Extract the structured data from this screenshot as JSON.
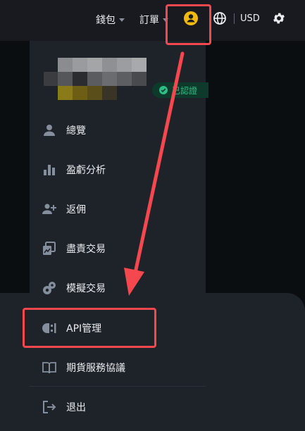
{
  "topbar": {
    "wallet_label": "錢包",
    "orders_label": "訂單",
    "user_icon": "user-circle-icon",
    "globe_icon": "globe-icon",
    "currency": "USD",
    "settings_icon": "gear-icon"
  },
  "profile": {
    "verified_label": "已認證",
    "verified_icon": "check-shield-icon"
  },
  "menu": {
    "items": [
      {
        "label": "總覽",
        "icon": "user-icon"
      },
      {
        "label": "盈虧分析",
        "icon": "bar-chart-icon"
      },
      {
        "label": "返佣",
        "icon": "add-user-icon"
      },
      {
        "label": "盡責交易",
        "icon": "trade-icon"
      },
      {
        "label": "模擬交易",
        "icon": "coins-icon"
      },
      {
        "label": "API管理",
        "icon": "api-icon"
      },
      {
        "label": "期貨服務協議",
        "icon": "book-icon"
      },
      {
        "label": "退出",
        "icon": "logout-icon"
      }
    ]
  },
  "colors": {
    "accent_yellow": "#f0b90b",
    "annotation_red": "#f5484e",
    "verified_green": "#2ebd85",
    "menu_bg": "#1e2329",
    "topbar_bg": "#181a20"
  }
}
